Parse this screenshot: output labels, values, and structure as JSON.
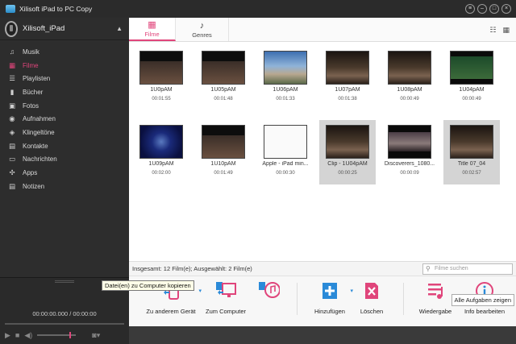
{
  "window": {
    "title": "Xilisoft iPad to PC Copy"
  },
  "device": {
    "name": "Xilisoft_iPad"
  },
  "sidebar": {
    "items": [
      {
        "label": "Musik",
        "icon": "♫"
      },
      {
        "label": "Filme",
        "icon": "▦"
      },
      {
        "label": "Playlisten",
        "icon": "☰"
      },
      {
        "label": "Bücher",
        "icon": "▮"
      },
      {
        "label": "Fotos",
        "icon": "▣"
      },
      {
        "label": "Aufnahmen",
        "icon": "◉"
      },
      {
        "label": "Klingeltöne",
        "icon": "◈"
      },
      {
        "label": "Kontakte",
        "icon": "▤"
      },
      {
        "label": "Nachrichten",
        "icon": "▭"
      },
      {
        "label": "Apps",
        "icon": "✣"
      },
      {
        "label": "Notizen",
        "icon": "▤"
      }
    ],
    "active_index": 1
  },
  "player": {
    "time": "00:00:00.000 / 00:00:00"
  },
  "tabs": [
    {
      "label": "Filme",
      "icon": "▦"
    },
    {
      "label": "Genres",
      "icon": "♪"
    }
  ],
  "movies": [
    {
      "title": "1U0pAM",
      "duration": "00:01:55",
      "thumb": "dark-text"
    },
    {
      "title": "1U05pAM",
      "duration": "00:01:48",
      "thumb": "dark-text"
    },
    {
      "title": "1U06pAM",
      "duration": "00:01:33",
      "thumb": "sky"
    },
    {
      "title": "1U07pAM",
      "duration": "00:01:38",
      "thumb": "people"
    },
    {
      "title": "1U08pAM",
      "duration": "00:00:49",
      "thumb": "people"
    },
    {
      "title": "1U04pAM",
      "duration": "00:00:49",
      "thumb": "green"
    },
    {
      "title": "1U09pAM",
      "duration": "00:02:00",
      "thumb": "blue"
    },
    {
      "title": "1U10pAM",
      "duration": "00:01:49",
      "thumb": "dark-text"
    },
    {
      "title": "Apple - iPad min...",
      "duration": "00:00:30",
      "thumb": "white"
    },
    {
      "title": "Clip - 1U04pAM",
      "duration": "00:00:25",
      "thumb": "people",
      "selected": true
    },
    {
      "title": "Discoverers_1080...",
      "duration": "00:00:09",
      "thumb": "dusk"
    },
    {
      "title": "Title 07_04",
      "duration": "00:02:57",
      "thumb": "people",
      "selected": true
    }
  ],
  "status": {
    "text": "Insgesamt: 12 Film(e); Ausgewählt: 2 Film(e)",
    "search_placeholder": "Filme suchen"
  },
  "toolbar": {
    "to_device": "Zu anderem Gerät",
    "to_computer": "Zum Computer",
    "add": "Hinzufügen",
    "delete": "Löschen",
    "play": "Wiedergabe",
    "info": "Info bearbeiten"
  },
  "tooltip": "Datei(en) zu Computer kopieren",
  "tasks_button": "Alle Aufgaben zeigen",
  "colors": {
    "accent": "#e0457b",
    "blue": "#2a8ad8",
    "sidebar": "#2d2d2d"
  }
}
